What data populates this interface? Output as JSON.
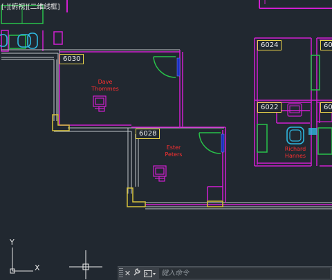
{
  "viewport": {
    "label": "[-][俯视][二维线框]"
  },
  "rooms": [
    {
      "number": "6030",
      "occupant_line1": "Dave",
      "occupant_line2": "Thommes"
    },
    {
      "number": "6028",
      "occupant_line1": "Ester",
      "occupant_line2": "Peters"
    },
    {
      "number": "6024"
    },
    {
      "number": "6022",
      "occupant_line1": "Richard",
      "occupant_line2": "Hannes"
    },
    {
      "number": "602"
    },
    {
      "number": "60"
    }
  ],
  "ucs": {
    "y_label": "Y",
    "x_label": "X"
  },
  "command_line": {
    "close_symbol": "✕",
    "customize_symbol": "🔧",
    "placeholder": "键入命令"
  },
  "colors": {
    "background": "#212830",
    "wall": "#c2c8cc",
    "partition": "#d11fd1",
    "door": "#29c34a",
    "furniture_cyan": "#2fb8e0",
    "tag_border": "#e8d24a",
    "occupant_text": "#ff3030",
    "window": "#1b2ec0",
    "column": "#d8c33c"
  }
}
